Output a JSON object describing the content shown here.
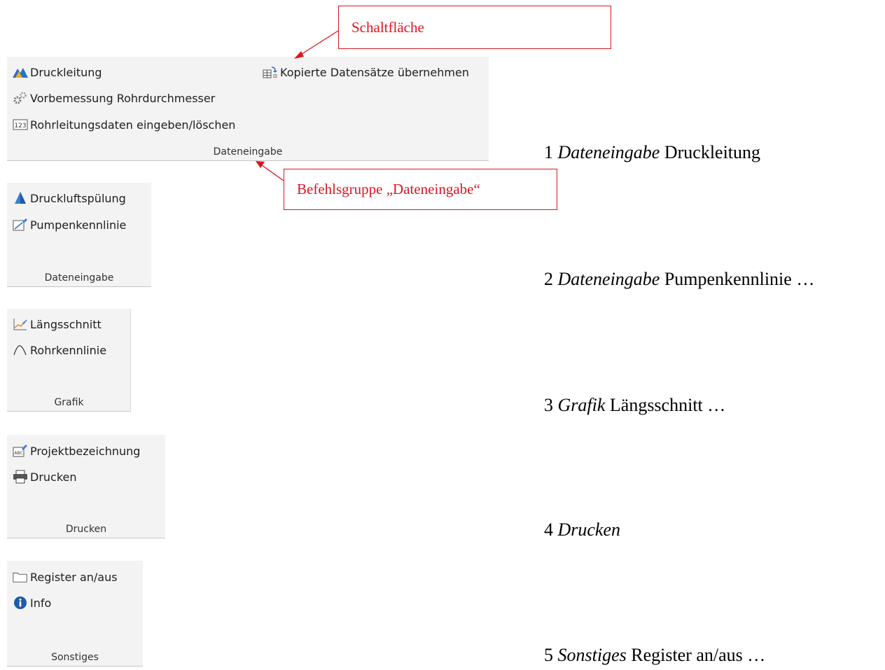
{
  "groups": [
    {
      "label": "Dateneingabe",
      "items": [
        {
          "label": "Druckleitung",
          "icon": "mountain-icon"
        },
        {
          "label": "Vorbemessung Rohrdurchmesser",
          "icon": "gears-icon"
        },
        {
          "label": "Rohrleitungsdaten eingeben/löschen",
          "icon": "numeric-123-icon"
        },
        {
          "label": "Kopierte Datensätze übernehmen",
          "icon": "paste-table-icon"
        }
      ]
    },
    {
      "label": "Dateneingabe",
      "items": [
        {
          "label": "Druckluftspülung",
          "icon": "cone-icon"
        },
        {
          "label": "Pumpenkennlinie",
          "icon": "chart-edit-icon"
        }
      ]
    },
    {
      "label": "Grafik",
      "items": [
        {
          "label": "Längsschnitt",
          "icon": "line-chart-icon"
        },
        {
          "label": "Rohrkennlinie",
          "icon": "curve-icon"
        }
      ]
    },
    {
      "label": "Drucken",
      "items": [
        {
          "label": "Projektbezeichnung",
          "icon": "abc-edit-icon"
        },
        {
          "label": "Drucken",
          "icon": "printer-icon"
        }
      ]
    },
    {
      "label": "Sonstiges",
      "items": [
        {
          "label": "Register an/aus",
          "icon": "folder-icon"
        },
        {
          "label": "Info",
          "icon": "info-icon"
        }
      ]
    }
  ],
  "callouts": {
    "button": "Schaltfläche",
    "group": "Befehlsgruppe „Dateneingabe“"
  },
  "captions": [
    {
      "num": "1",
      "tab": "Dateneingabe",
      "rest": "Druckleitung"
    },
    {
      "num": "2",
      "tab": "Dateneingabe",
      "rest": "Pumpenkennlinie …"
    },
    {
      "num": "3",
      "tab": "Grafik",
      "rest": "Längsschnitt …"
    },
    {
      "num": "4",
      "tab": "Drucken",
      "rest": ""
    },
    {
      "num": "5",
      "tab": "Sonstiges",
      "rest": "Register an/aus …"
    }
  ],
  "colors": {
    "accent": "#e0141e",
    "panel": "#f3f3f3"
  }
}
